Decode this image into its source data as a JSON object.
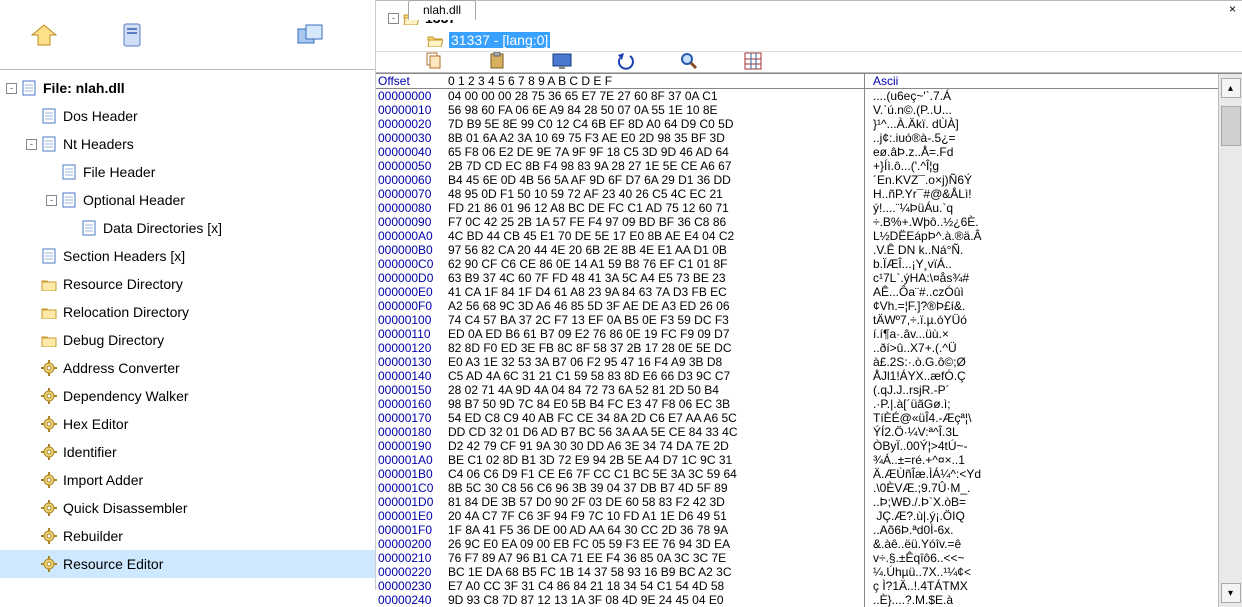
{
  "left_toolbar": {
    "open": "open",
    "history": "history",
    "windows": "windows"
  },
  "tree": [
    {
      "depth": 0,
      "exp": "-",
      "icon": "page",
      "label": "File: nlah.dll",
      "bold": true,
      "interact": true
    },
    {
      "depth": 1,
      "exp": "",
      "icon": "page",
      "label": "Dos Header",
      "interact": true
    },
    {
      "depth": 1,
      "exp": "-",
      "icon": "page",
      "label": "Nt Headers",
      "interact": true
    },
    {
      "depth": 2,
      "exp": "",
      "icon": "page",
      "label": "File Header",
      "interact": true
    },
    {
      "depth": 2,
      "exp": "-",
      "icon": "page",
      "label": "Optional Header",
      "interact": true
    },
    {
      "depth": 3,
      "exp": "",
      "icon": "page",
      "label": "Data Directories [x]",
      "interact": true
    },
    {
      "depth": 1,
      "exp": "",
      "icon": "page",
      "label": "Section Headers [x]",
      "interact": true
    },
    {
      "depth": 1,
      "exp": "",
      "icon": "folder",
      "label": "Resource Directory",
      "interact": true
    },
    {
      "depth": 1,
      "exp": "",
      "icon": "folder",
      "label": "Relocation Directory",
      "interact": true
    },
    {
      "depth": 1,
      "exp": "",
      "icon": "folder",
      "label": "Debug Directory",
      "interact": true
    },
    {
      "depth": 1,
      "exp": "",
      "icon": "gear",
      "label": "Address Converter",
      "interact": true
    },
    {
      "depth": 1,
      "exp": "",
      "icon": "gear",
      "label": "Dependency Walker",
      "interact": true
    },
    {
      "depth": 1,
      "exp": "",
      "icon": "gear",
      "label": "Hex Editor",
      "interact": true
    },
    {
      "depth": 1,
      "exp": "",
      "icon": "gear",
      "label": "Identifier",
      "interact": true
    },
    {
      "depth": 1,
      "exp": "",
      "icon": "gear",
      "label": "Import Adder",
      "interact": true
    },
    {
      "depth": 1,
      "exp": "",
      "icon": "gear",
      "label": "Quick Disassembler",
      "interact": true
    },
    {
      "depth": 1,
      "exp": "",
      "icon": "gear",
      "label": "Rebuilder",
      "interact": true
    },
    {
      "depth": 1,
      "exp": "",
      "icon": "gear",
      "label": "Resource Editor",
      "selected": true,
      "interact": true
    }
  ],
  "tab": {
    "label": "nlah.dll",
    "close": "×"
  },
  "res_tree": [
    {
      "depth": 0,
      "exp": "-",
      "icon": "folder-open",
      "label": "1337",
      "bold": true
    },
    {
      "depth": 1,
      "exp": "",
      "icon": "folder-open",
      "label": "31337 - [lang:0]",
      "selected": true
    }
  ],
  "hex_toolbar": [
    "copy",
    "paste",
    "screen",
    "undo",
    "search",
    "grid"
  ],
  "hex_header": {
    "offset": "Offset",
    "cols": "0  1  2  3  4  5  6  7  8  9  A  B  C  D  E  F",
    "ascii": "Ascii"
  },
  "hex_rows": [
    {
      "off": "00000000",
      "hex": "04 00 00 00 28 75 36 65 E7 7E 27 60 8F 37 0A C1",
      "asc": "....(u6eç~'`.7.Á"
    },
    {
      "off": "00000010",
      "hex": "56 98 60 FA 06 6E A9 84 28 50 07 0A 55 1E 10 8E",
      "asc": "V.`ú.n©.(P..U..."
    },
    {
      "off": "00000020",
      "hex": "7D B9 5E 8E 99 C0 12 C4 6B EF 8D A0 64 D9 C0 5D",
      "asc": "}¹^...À.Äkï. dÙÀ]"
    },
    {
      "off": "00000030",
      "hex": "8B 01 6A A2 3A 10 69 75 F3 AE E0 2D 98 35 BF 3D",
      "asc": "..j¢:.iuó®à-.5¿="
    },
    {
      "off": "00000040",
      "hex": "65 F8 06 E2 DE 9E 7A 9F 9F 18 C5 3D 9D 46 AD 64",
      "asc": "eø.âÞ.z..Å=.F­d"
    },
    {
      "off": "00000050",
      "hex": "2B 7D CD EC 8B F4 98 83 9A 28 27 1E 5E CE A6 67",
      "asc": "+}Íì.ô...('.^Î¦g"
    },
    {
      "off": "00000060",
      "hex": "B4 45 6E 0D 4B 56 5A AF 9D 6F D7 6A 29 D1 36 DD",
      "asc": "´En.KVZ¯.o×j)Ñ6Ý"
    },
    {
      "off": "00000070",
      "hex": "48 95 0D F1 50 10 59 72 AF 23 40 26 C5 4C EC 21",
      "asc": "H..ñP.Yr¯#@&ÅLì!"
    },
    {
      "off": "00000080",
      "hex": "FD 21 86 01 96 12 A8 BC DE FC C1 AD 75 12 60 71",
      "asc": "ý!....¨¼ÞüÁ­u.`q"
    },
    {
      "off": "00000090",
      "hex": "F7 0C 42 25 2B 1A 57 FE F4 97 09 BD BF 36 C8 86",
      "asc": "÷.B%+.Wþô..½¿6È."
    },
    {
      "off": "000000A0",
      "hex": "4C BD 44 CB 45 E1 70 DE 5E 17 E0 8B AE E4 04 C2",
      "asc": "L½DËEápÞ^.à.®ä.Â"
    },
    {
      "off": "000000B0",
      "hex": "97 56 82 CA 20 44 4E 20 6B 2E 8B 4E E1 AA D1 0B",
      "asc": ".V.Ê DN k..Ná°Ñ."
    },
    {
      "off": "000000C0",
      "hex": "62 90 CF C6 CE 86 0E 14 A1 59 B8 76 EF C1 01 8F",
      "asc": "b.ÏÆÎ...¡Y¸vïÁ.."
    },
    {
      "off": "000000D0",
      "hex": "63 B9 37 4C 60 7F FD 48 41 3A 5C A4 E5 73 BE 23",
      "asc": "c¹7L`.ýHA:\\¤ås¾#"
    },
    {
      "off": "000000E0",
      "hex": "41 CA 1F 84 1F D4 61 A8 23 9A 84 63 7A D3 FB EC",
      "asc": "AÊ...Ôa¨#..czÓûì"
    },
    {
      "off": "000000F0",
      "hex": "A2 56 68 9C 3D A6 46 85 5D 3F AE DE A3 ED 26 06",
      "asc": "¢Vh.=¦F.]?®Þ£í&."
    },
    {
      "off": "00000100",
      "hex": "74 C4 57 BA 37 2C F7 13 EF 0A B5 0E F3 59 DC F3",
      "asc": "tÄWº7,÷.ï.µ.óYÜó"
    },
    {
      "off": "00000110",
      "hex": "ED 0A ED B6 61 B7 09 E2 76 86 0E 19 FC F9 09 D7",
      "asc": "í.í¶a·.âv...üù.×"
    },
    {
      "off": "00000120",
      "hex": "82 8D F0 ED 3E FB 8C 8F 58 37 2B 17 28 0E 5E DC",
      "asc": "..ðí>û..X7+.(.^Ü"
    },
    {
      "off": "00000130",
      "hex": "E0 A3 1E 32 53 3A B7 06 F2 95 47 16 F4 A9 3B D8",
      "asc": "à£.2S:·.ò.G.ô©;Ø"
    },
    {
      "off": "00000140",
      "hex": "C5 AD 4A 6C 31 21 C1 59 58 83 8D E6 66 D3 9C C7",
      "asc": "Å­Jl1!ÁYX..æfÓ.Ç"
    },
    {
      "off": "00000150",
      "hex": "28 02 71 4A 9D 4A 04 84 72 73 6A 52 81 2D 50 B4",
      "asc": "(.qJ.J..rsjR.-P´"
    },
    {
      "off": "00000160",
      "hex": "98 B7 50 9D 7C 84 E0 5B B4 FC E3 47 F8 06 EC 3B",
      "asc": ".·P.|.à[´üãGø.ì;"
    },
    {
      "off": "00000170",
      "hex": "54 ED C8 C9 40 AB FC CE 34 8A 2D C6 E7 AA A6 5C",
      "asc": "TíÈÉ@«üÎ4.-Æçª¦\\"
    },
    {
      "off": "00000180",
      "hex": "DD CD 32 01 D6 AD B7 BC 56 3A AA 5E CE 84 33 4C",
      "asc": "ÝÍ2.Ö­·¼V:ª^Î.3L"
    },
    {
      "off": "00000190",
      "hex": "D2 42 79 CF 91 9A 30 30 DD A6 3E 34 74 DA 7E 2D",
      "asc": "ÒByÏ..00Ý¦>4tÚ~-"
    },
    {
      "off": "000001A0",
      "hex": "BE C1 02 8D B1 3D 72 E9 94 2B 5E A4 D7 1C 9C 31",
      "asc": "¾Á..±=ré.+^¤×..1"
    },
    {
      "off": "000001B0",
      "hex": "C4 06 C6 D9 F1 CE E6 7F CC C1 BC 5E 3A 3C 59 64",
      "asc": "Ä.ÆÙñÎæ.ÌÁ¼^:<Yd"
    },
    {
      "off": "000001C0",
      "hex": "8B 5C 30 C8 56 C6 96 3B 39 04 37 DB B7 4D 5F 89",
      "asc": ".\\0ÈVÆ.;9.7Û·M_."
    },
    {
      "off": "000001D0",
      "hex": "81 84 DE 3B 57 D0 90 2F 03 DE 60 58 83 F2 42 3D",
      "asc": "..Þ;WÐ./.Þ`X.òB="
    },
    {
      "off": "000001E0",
      "hex": "20 4A C7 7F C6 3F 94 F9 7C 10 FD A1 1E D6 49 51",
      "asc": " JÇ.Æ?.ù|.ý¡.ÖIQ"
    },
    {
      "off": "000001F0",
      "hex": "1F 8A 41 F5 36 DE 00 AD AA 64 30 CC 2D 36 78 9A",
      "asc": "..Aõ6Þ.­ªd0Ì-6x."
    },
    {
      "off": "00000200",
      "hex": "26 9C E0 EA 09 00 EB FC 05 59 F3 EE 76 94 3D EA",
      "asc": "&.àê..ëü.Yóîv.=ê"
    },
    {
      "off": "00000210",
      "hex": "76 F7 89 A7 96 B1 CA 71 EE F4 36 85 0A 3C 3C 7E",
      "asc": "v÷.§.±Êqîô6..<<~"
    },
    {
      "off": "00000220",
      "hex": "BC 1E DA 68 B5 FC 1B 14 37 58 93 16 B9 BC A2 3C",
      "asc": "¼.Úhµü..7X..¹¼¢<"
    },
    {
      "off": "00000230",
      "hex": "E7 A0 CC 3F 31 C4 86 84 21 18 34 54 C1 54 4D 58",
      "asc": "ç Ì?1Ä..!.4TÁTMX"
    },
    {
      "off": "00000240",
      "hex": "9D 93 C8 7D 87 12 13 1A 3F 08 4D 9E 24 45 04 E0",
      "asc": "..È}....?.M.$E.à"
    }
  ]
}
